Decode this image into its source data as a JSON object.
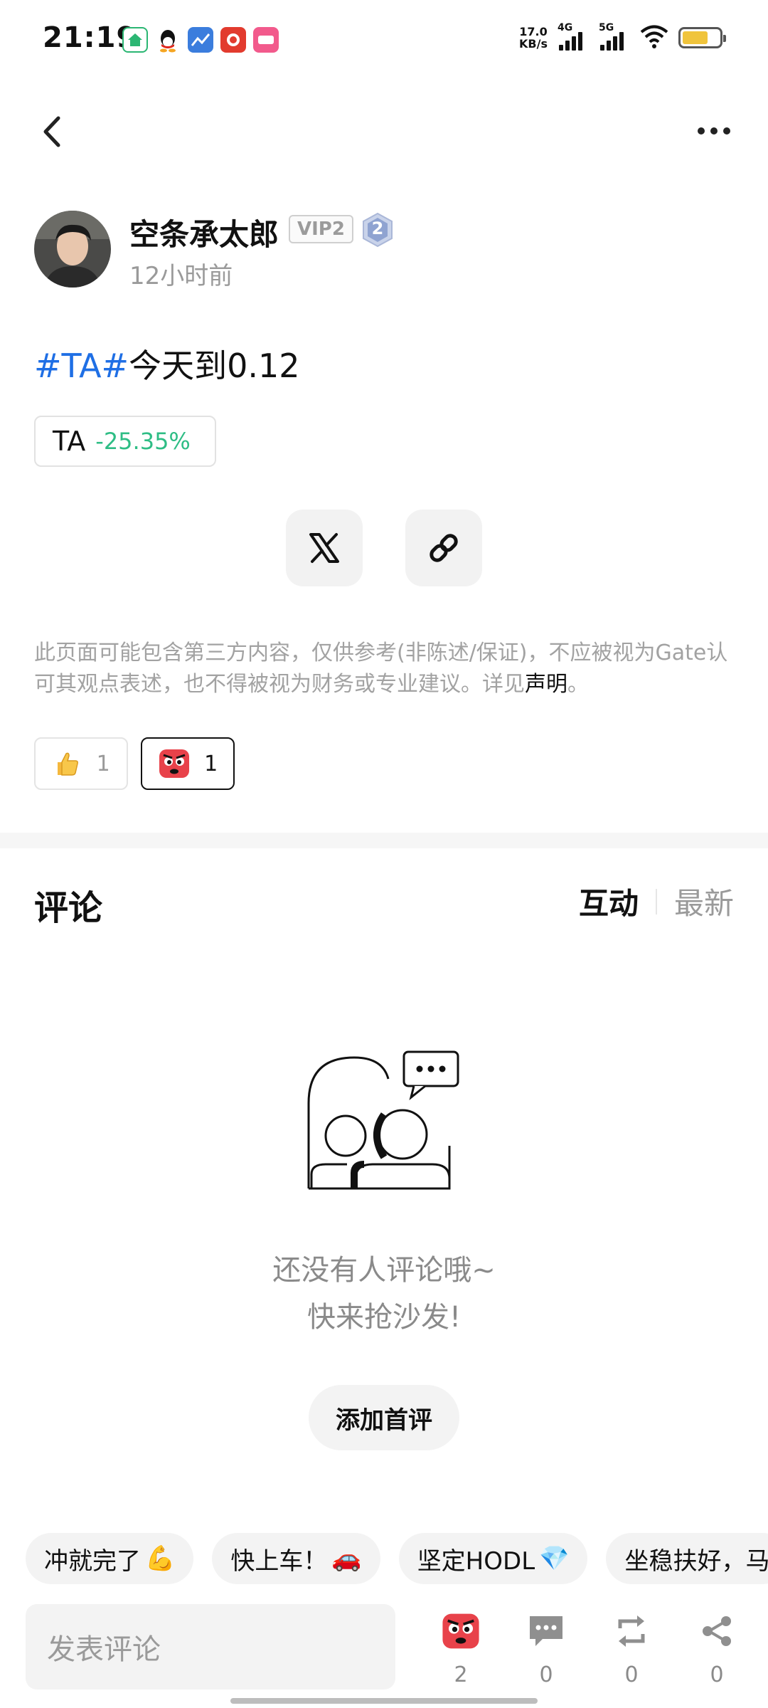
{
  "status_bar": {
    "time": "21:19",
    "net_speed_value": "17.0",
    "net_speed_unit": "KB/s",
    "net1_label": "4G",
    "net2_label": "5G",
    "app_icons": [
      "mall-app-icon",
      "qq-icon",
      "finance-app-icon",
      "taobao-icon",
      "lalala-app-icon"
    ]
  },
  "header": {
    "back_icon": "chevron-left-icon",
    "more_icon": "more-dots-icon"
  },
  "author": {
    "name": "空条承太郎",
    "vip": "VIP2",
    "level": "2",
    "time": "12小时前"
  },
  "post": {
    "hashtag": "#TA#",
    "text": "今天到0.12",
    "token": {
      "symbol": "TA",
      "change": "-25.35%",
      "change_color": "#2ebd85"
    }
  },
  "share": {
    "x_icon": "x-logo-icon",
    "link_icon": "link-icon"
  },
  "disclaimer": {
    "text": "此页面可能包含第三方内容，仅供参考(非陈述/保证)，不应被视为Gate认可其观点表述，也不得被视为财务或专业建议。详见",
    "link": "声明",
    "end": "。"
  },
  "reactions": [
    {
      "icon": "thumbs-up-icon",
      "count": "1"
    },
    {
      "icon": "angry-face-icon",
      "count": "1"
    }
  ],
  "comments": {
    "title": "评论",
    "sort_tabs": [
      "互动",
      "最新"
    ],
    "empty_line1": "还没有人评论哦~",
    "empty_line2": "快来抢沙发!",
    "first_comment_button": "添加首评",
    "quick_replies": [
      {
        "text": "冲就完了",
        "emoji": "💪"
      },
      {
        "text": "快上车！",
        "emoji": "🚗"
      },
      {
        "text": "坚定HODL",
        "emoji": "💎"
      },
      {
        "text": "坐稳扶好，马",
        "emoji": ""
      }
    ]
  },
  "bottom_bar": {
    "input_placeholder": "发表评论",
    "actions": [
      {
        "icon": "angry-face-icon",
        "count": "2"
      },
      {
        "icon": "comment-bubble-icon",
        "count": "0"
      },
      {
        "icon": "repost-icon",
        "count": "0"
      },
      {
        "icon": "share-icon",
        "count": "0"
      }
    ]
  },
  "colors": {
    "hashtag": "#1f6fe5",
    "price_change": "#2ebd85",
    "muted_text": "#9a9a9a"
  }
}
